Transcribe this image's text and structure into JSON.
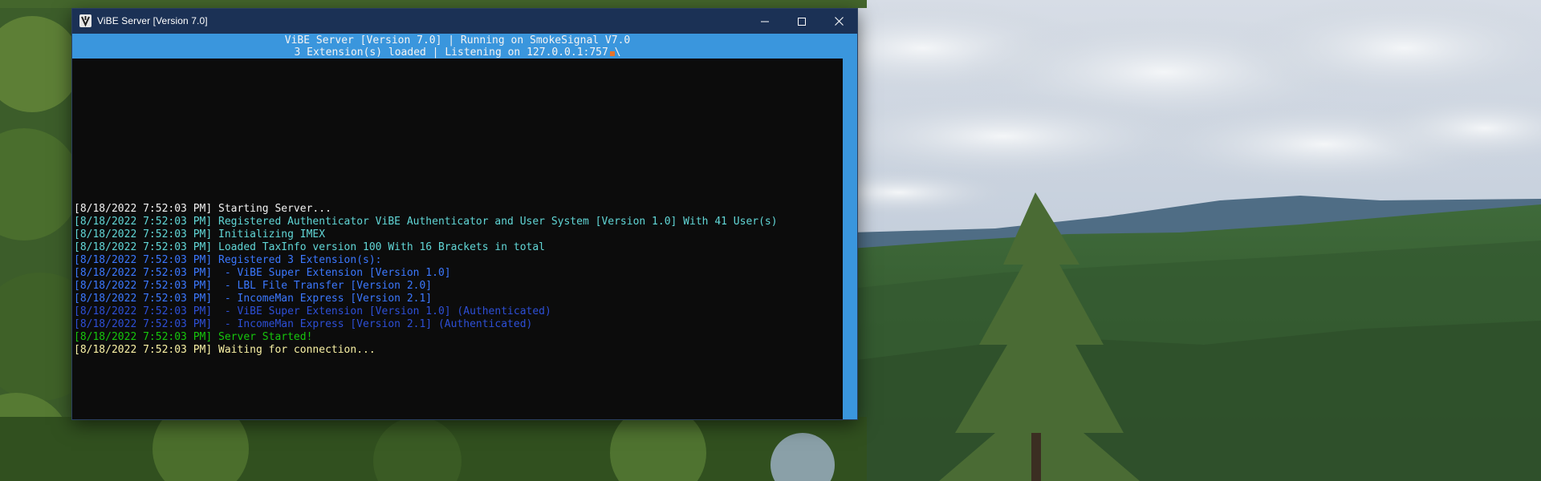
{
  "window": {
    "title": "ViBE Server [Version 7.0]",
    "icon": "vibe-app-icon",
    "controls": {
      "minimize": "minimize-icon",
      "maximize": "maximize-icon",
      "close": "close-icon"
    }
  },
  "header": {
    "line1": "ViBE Server [Version 7.0] | Running on SmokeSignal V7.0",
    "line2": "3 Extension(s) loaded | Listening on 127.0.0.1:757 \\"
  },
  "colors": {
    "titlebar": "#1b3155",
    "header_band": "#3a96dd",
    "console_bg": "#0c0c0c",
    "white": "#f2f2f2",
    "cyan": "#61d6d6",
    "blue": "#3b78ff",
    "dark_blue": "#2d4fd6",
    "green": "#16c60c",
    "yellow": "#f9f1a5"
  },
  "log": [
    {
      "text": "[8/18/2022 7:52:03 PM] Starting Server...",
      "color": "#f2f2f2"
    },
    {
      "text": "[8/18/2022 7:52:03 PM] Registered Authenticator ViBE Authenticator and User System [Version 1.0] With 41 User(s)",
      "color": "#61d6d6"
    },
    {
      "text": "[8/18/2022 7:52:03 PM] Initializing IMEX",
      "color": "#61d6d6"
    },
    {
      "text": "[8/18/2022 7:52:03 PM] Loaded TaxInfo version 100 With 16 Brackets in total",
      "color": "#61d6d6"
    },
    {
      "text": "[8/18/2022 7:52:03 PM] Registered 3 Extension(s):",
      "color": "#3b78ff"
    },
    {
      "text": "[8/18/2022 7:52:03 PM]  - ViBE Super Extension [Version 1.0]",
      "color": "#3b78ff"
    },
    {
      "text": "[8/18/2022 7:52:03 PM]  - LBL File Transfer [Version 2.0]",
      "color": "#3b78ff"
    },
    {
      "text": "[8/18/2022 7:52:03 PM]  - IncomeMan Express [Version 2.1]",
      "color": "#3b78ff"
    },
    {
      "text": "[8/18/2022 7:52:03 PM]  - ViBE Super Extension [Version 1.0] (Authenticated)",
      "color": "#2d4fd6"
    },
    {
      "text": "[8/18/2022 7:52:03 PM]  - IncomeMan Express [Version 2.1] (Authenticated)",
      "color": "#2d4fd6"
    },
    {
      "text": "[8/18/2022 7:52:03 PM] Server Started!",
      "color": "#16c60c"
    },
    {
      "text": "[8/18/2022 7:52:03 PM] Waiting for connection...",
      "color": "#f9f1a5"
    }
  ]
}
